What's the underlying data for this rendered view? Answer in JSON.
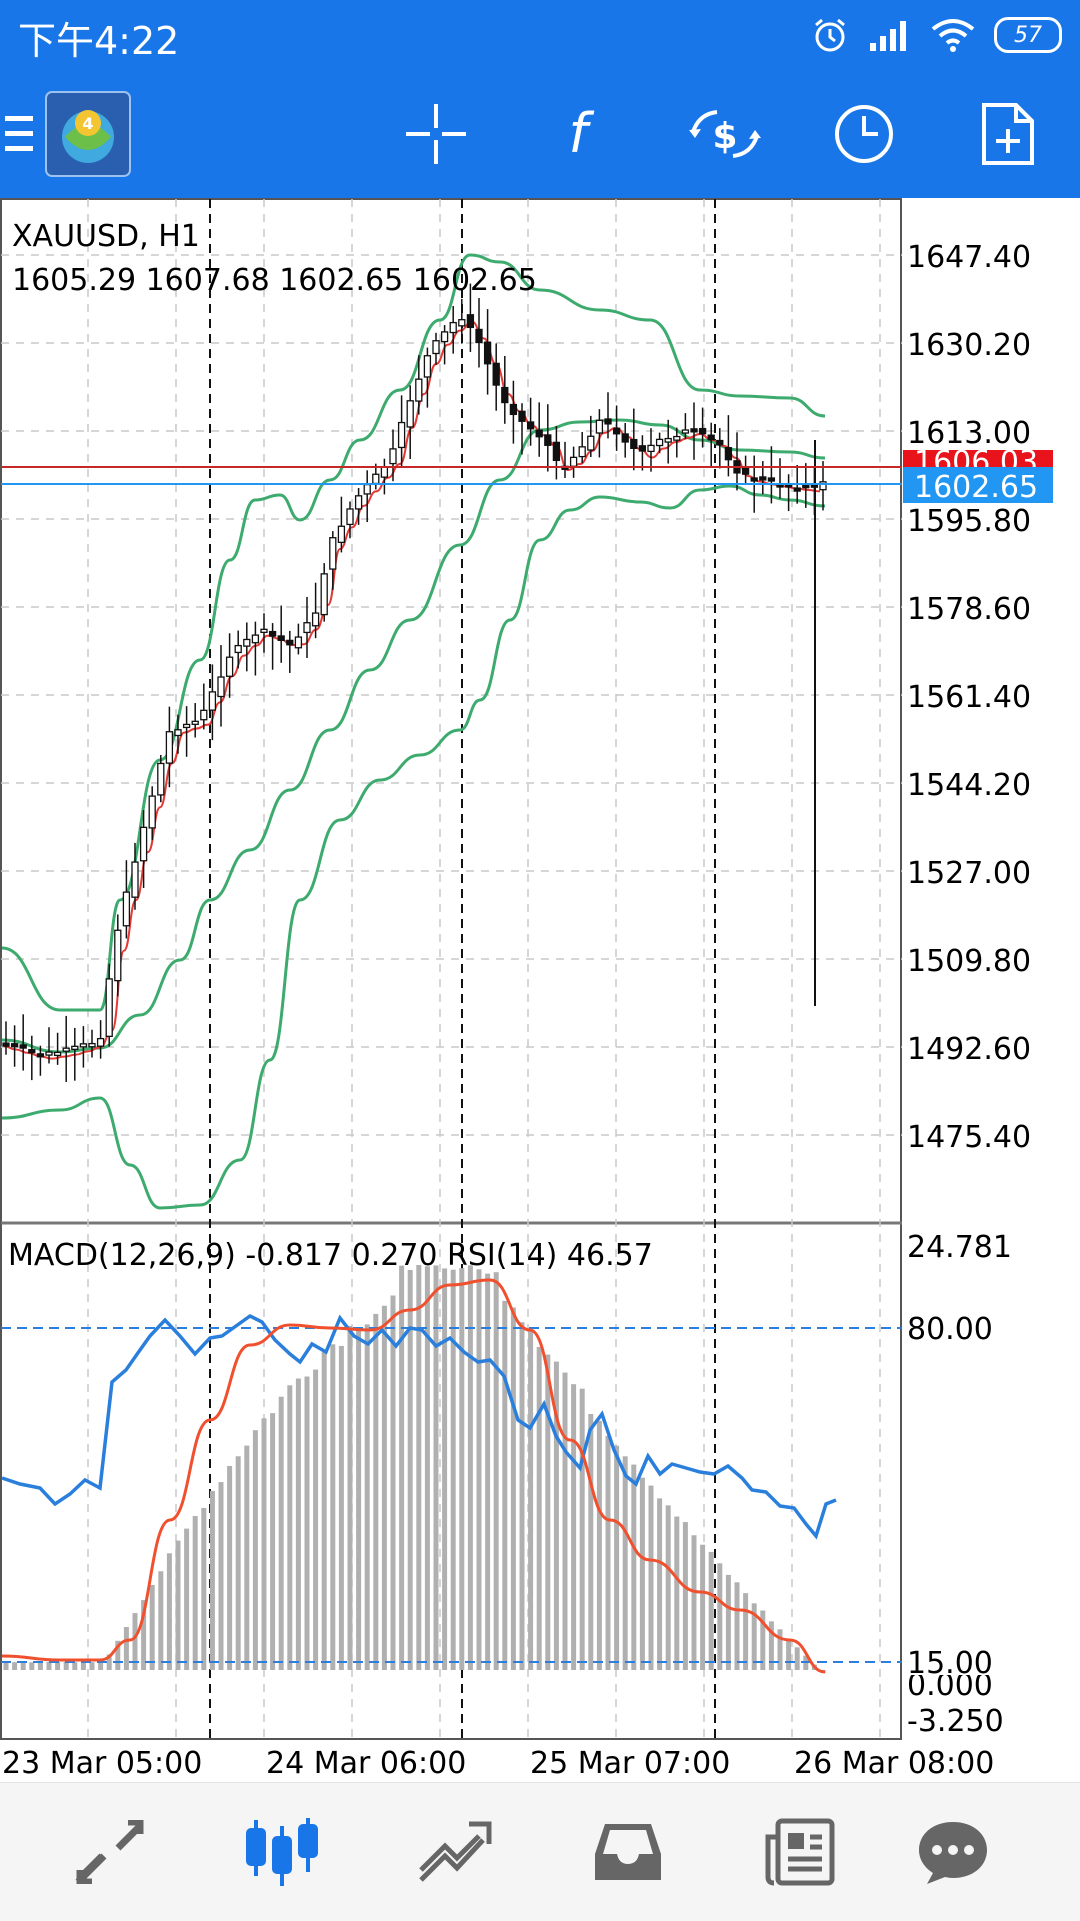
{
  "status_bar": {
    "time": "下午4:22",
    "battery": "57"
  },
  "toolbar": {
    "icons": [
      "menu-icon",
      "app-logo",
      "crosshair-icon",
      "function-icon",
      "trade-icon",
      "clock-icon",
      "new-order-icon"
    ],
    "function_glyph": "f"
  },
  "chart": {
    "symbol_label": "XAUUSD, H1",
    "ohlc_label": "1605.29 1607.68 1602.65 1602.65",
    "indicator_label": "MACD(12,26,9) -0.817 0.270 RSI(14) 46.57",
    "price_ticks": [
      "1647.40",
      "1630.20",
      "1613.00",
      "1595.80",
      "1578.60",
      "1561.40",
      "1544.20",
      "1527.00",
      "1509.80",
      "1492.60",
      "1475.40"
    ],
    "ask_label": "1606.03",
    "bid_label": "1602.65",
    "indicator_ticks": [
      "24.781",
      "80.00",
      "15.00",
      "0.000",
      "-3.250"
    ],
    "time_ticks": [
      "23 Mar 05:00",
      "24 Mar 06:00",
      "25 Mar 07:00",
      "26 Mar 08:00"
    ],
    "colors": {
      "bollinger": "#3DAA6E",
      "ma": "#E53935",
      "ask_line": "#C62828",
      "bid_line": "#2196F3",
      "rsi": "#2A7FDC",
      "macd_signal": "#F0502E",
      "histogram": "#B0B0B0"
    }
  },
  "bottom_nav": {
    "items": [
      {
        "name": "quotes-icon",
        "active": false
      },
      {
        "name": "chart-icon",
        "active": true
      },
      {
        "name": "trade-icon",
        "active": false
      },
      {
        "name": "history-icon",
        "active": false
      },
      {
        "name": "news-icon",
        "active": false
      },
      {
        "name": "chat-icon",
        "active": false
      }
    ],
    "active_color": "#1976E8",
    "inactive_color": "#666666"
  }
}
